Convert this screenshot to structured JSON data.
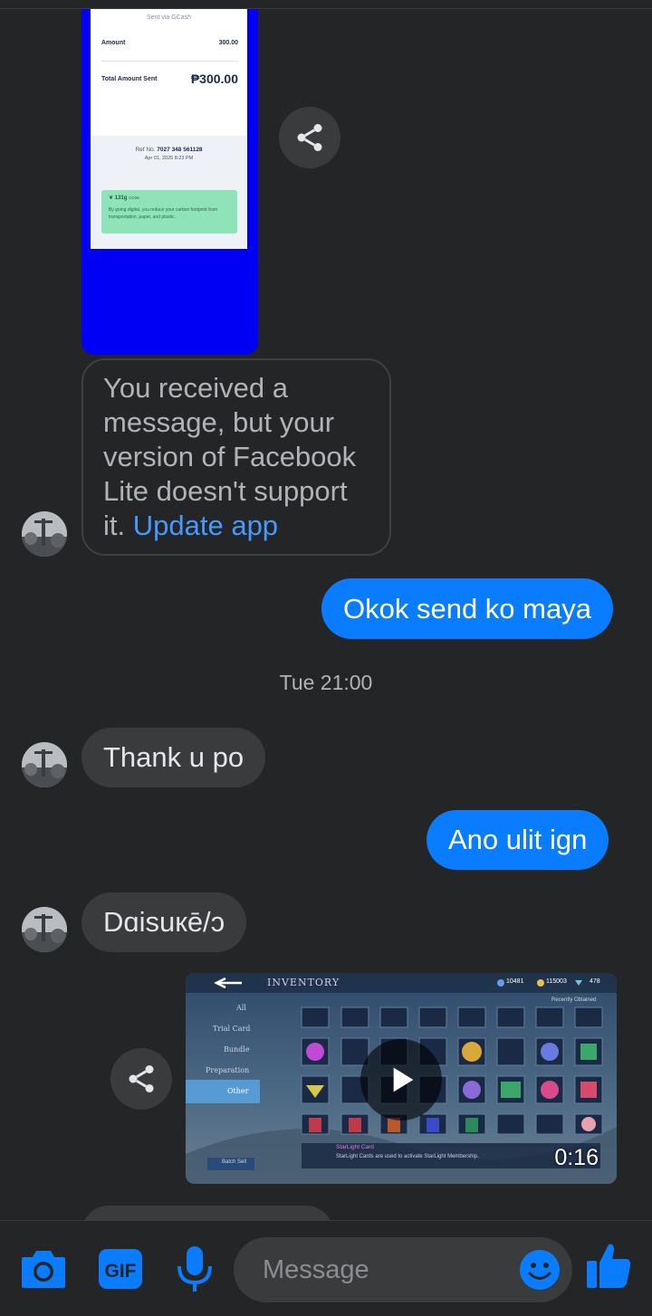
{
  "receipt": {
    "sent_via": "Sent via GCash",
    "amount_label": "Amount",
    "amount_value": "300.00",
    "total_label": "Total Amount Sent",
    "total_value": "₱300.00",
    "ref_label": "Ref No.",
    "ref_value": "7027 348 561128",
    "ref_date": "Apr 01, 2025 8:23 PM",
    "carbon_value": "131g",
    "carbon_unit": "CO2e",
    "carbon_text": "By going digital, you reduce your carbon footprint from transportation, paper, and plastic."
  },
  "messages": {
    "notice_text": "You received a message, but your version of Facebook Lite doesn't support it.",
    "notice_link": "Update app",
    "out1": "Okok send ko maya",
    "timestamp": "Tue 21:00",
    "in1": "Thank u po",
    "out2": "Ano ulit ign",
    "in2": "Dɑisuкē/ɔ"
  },
  "video": {
    "title": "INVENTORY",
    "duration": "0:16",
    "tabs": [
      "All",
      "Trial Card",
      "Bundle",
      "Preparation",
      "Other"
    ],
    "resources": [
      "10481",
      "115003",
      "478"
    ],
    "recently_obtained": "Recently Obtained",
    "card_title": "StarLight Card",
    "card_desc": "StarLight Cards are used to activate StarLight Membership.",
    "batch_sell": "Batch Sell"
  },
  "composer": {
    "placeholder": "Message"
  },
  "colors": {
    "background": "#242526",
    "bubble_in": "#3a3b3c",
    "bubble_out": "#0a7cff",
    "icon_blue": "#0a7cff",
    "link": "#4599ff"
  },
  "icons": [
    "share-icon",
    "camera-icon",
    "gif-icon",
    "microphone-icon",
    "emoji-icon",
    "thumbs-up-icon",
    "play-icon"
  ]
}
